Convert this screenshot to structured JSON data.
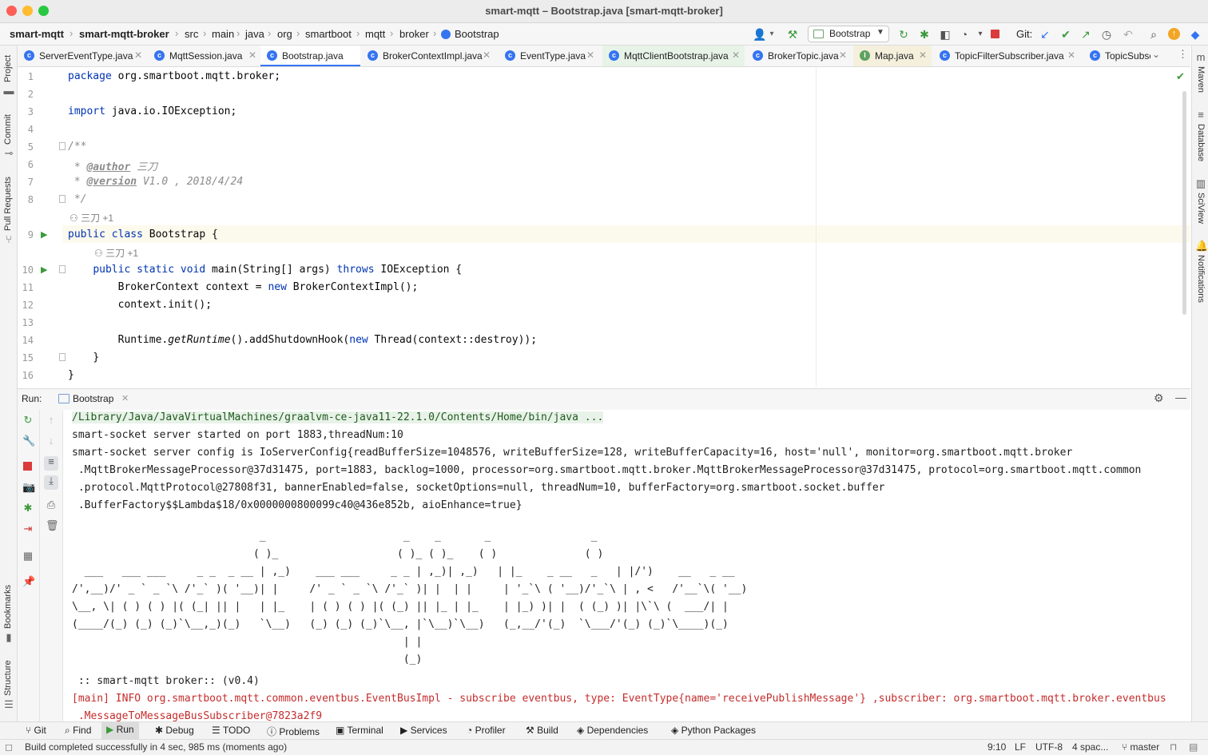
{
  "window": {
    "title": "smart-mqtt – Bootstrap.java [smart-mqtt-broker]",
    "traffic_colors": [
      "#ff5f57",
      "#febc2e",
      "#28c840"
    ]
  },
  "breadcrumbs": [
    "smart-mqtt",
    "smart-mqtt-broker",
    "src",
    "main",
    "java",
    "org",
    "smartboot",
    "mqtt",
    "broker",
    "Bootstrap"
  ],
  "toolbar": {
    "run_config": "Bootstrap",
    "git_label": "Git:"
  },
  "tabs": [
    {
      "label": "ServerEventType.java",
      "icon": "class-icon"
    },
    {
      "label": "MqttSession.java",
      "icon": "class-icon"
    },
    {
      "label": "Bootstrap.java",
      "icon": "class-icon",
      "active": true
    },
    {
      "label": "BrokerContextImpl.java",
      "icon": "class-icon"
    },
    {
      "label": "EventType.java",
      "icon": "class-icon"
    },
    {
      "label": "MqttClientBootstrap.java",
      "icon": "class-icon"
    },
    {
      "label": "BrokerTopic.java",
      "icon": "class-icon"
    },
    {
      "label": "Map.java",
      "icon": "interface-icon"
    },
    {
      "label": "TopicFilterSubscriber.java",
      "icon": "class-icon"
    },
    {
      "label": "TopicSubsc",
      "icon": "class-icon"
    }
  ],
  "left_stripe": [
    "Project",
    "Commit",
    "Pull Requests",
    "Bookmarks",
    "Structure"
  ],
  "right_stripe": [
    "Maven",
    "Database",
    "SciView",
    "Notifications"
  ],
  "editor": {
    "line_numbers": [
      "1",
      "2",
      "3",
      "4",
      "5",
      "6",
      "7",
      "8",
      "9",
      "10",
      "11",
      "12",
      "13",
      "14",
      "15",
      "16"
    ],
    "lines": {
      "l1_kw": "package",
      "l1_rest": " org.smartboot.mqtt.broker;",
      "l3_kw": "import",
      "l3_rest": " java.io.IOException;",
      "l5": "/**",
      "l6_star": " * ",
      "l6_tag": "@author",
      "l6_val": " 三刀",
      "l7_star": " * ",
      "l7_tag": "@version",
      "l7_val": " V1.0 , 2018/4/24",
      "l8": " */",
      "l9_kw": "public class",
      "l9_rest": " Bootstrap {",
      "l10_kw1": "public static void",
      "l10_mid": " main(String[] args) ",
      "l10_kw2": "throws",
      "l10_rest": " IOException {",
      "l11_a": "BrokerContext context = ",
      "l11_kw": "new",
      "l11_b": " BrokerContextImpl();",
      "l12": "context.init();",
      "l14_a": "Runtime.",
      "l14_it": "getRuntime",
      "l14_b": "().addShutdownHook(",
      "l14_kw": "new",
      "l14_c": " Thread(context::destroy));",
      "l15": "}",
      "l16": "}"
    },
    "author_hint_1": "三刀 +1",
    "author_hint_2": "三刀 +1"
  },
  "run_panel": {
    "label": "Run:",
    "tab": "Bootstrap",
    "console": {
      "path": "/Library/Java/JavaVirtualMachines/graalvm-ce-java11-22.1.0/Contents/Home/bin/java ...",
      "line1": "smart-socket server started on port 1883,threadNum:10",
      "line2": "smart-socket server config is IoServerConfig{readBufferSize=1048576, writeBufferSize=128, writeBufferCapacity=16, host='null', monitor=org.smartboot.mqtt.broker",
      "line3": " .MqttBrokerMessageProcessor@37d31475, port=1883, backlog=1000, processor=org.smartboot.mqtt.broker.MqttBrokerMessageProcessor@37d31475, protocol=org.smartboot.mqtt.common",
      "line4": " .protocol.MqttProtocol@27808f31, bannerEnabled=false, socketOptions=null, threadNum=10, bufferFactory=org.smartboot.socket.buffer",
      "line5": " .BufferFactory$$Lambda$18/0x0000000800099c40@436e852b, aioEnhance=true}",
      "banner": "                              _                      _    _       _                _\n                             ( )_                   ( )_ ( )_    ( )              ( )\n  ___   ___ ___     _ _  _ __ | ,_)    ___ ___     _ _ | ,_)| ,_)   | |_    _ __   _   | |/')    __   _ __\n/',__)/' _ ` _ `\\ /'_` )( '__)| |     /' _ ` _ `\\ /'_` )| |  | |     | '_`\\ ( '__)/'_`\\ | , <   /'__`\\( '__)\n\\__, \\| ( ) ( ) |( (_| || |   | |_    | ( ) ( ) |( (_) || |_ | |_    | |_) )| |  ( (_) )| |\\`\\ (  ___/| |\n(____/(_) (_) (_)`\\__,_)(_)   `\\__)   (_) (_) (_)`\\__, |`\\__)`\\__)   (_,__/'(_)  `\\___/'(_) (_)`\\____)(_)\n                                                     | |\n                                                     (_)",
      "version": " :: smart-mqtt broker:: (v0.4)",
      "info1": "[main] INFO org.smartboot.mqtt.common.eventbus.EventBusImpl - subscribe eventbus, type: EventType{name='receivePublishMessage'} ,subscriber: org.smartboot.mqtt.broker.eventbus",
      "info2": " .MessageToMessageBusSubscriber@7823a2f9"
    }
  },
  "bottom_tools": [
    "Git",
    "Find",
    "Run",
    "Debug",
    "TODO",
    "Problems",
    "Terminal",
    "Services",
    "Profiler",
    "Build",
    "Dependencies",
    "Python Packages"
  ],
  "status": {
    "message": "Build completed successfully in 4 sec, 985 ms (moments ago)",
    "position": "9:10",
    "line_sep": "LF",
    "encoding": "UTF-8",
    "indent": "4 spac...",
    "branch": "master"
  }
}
